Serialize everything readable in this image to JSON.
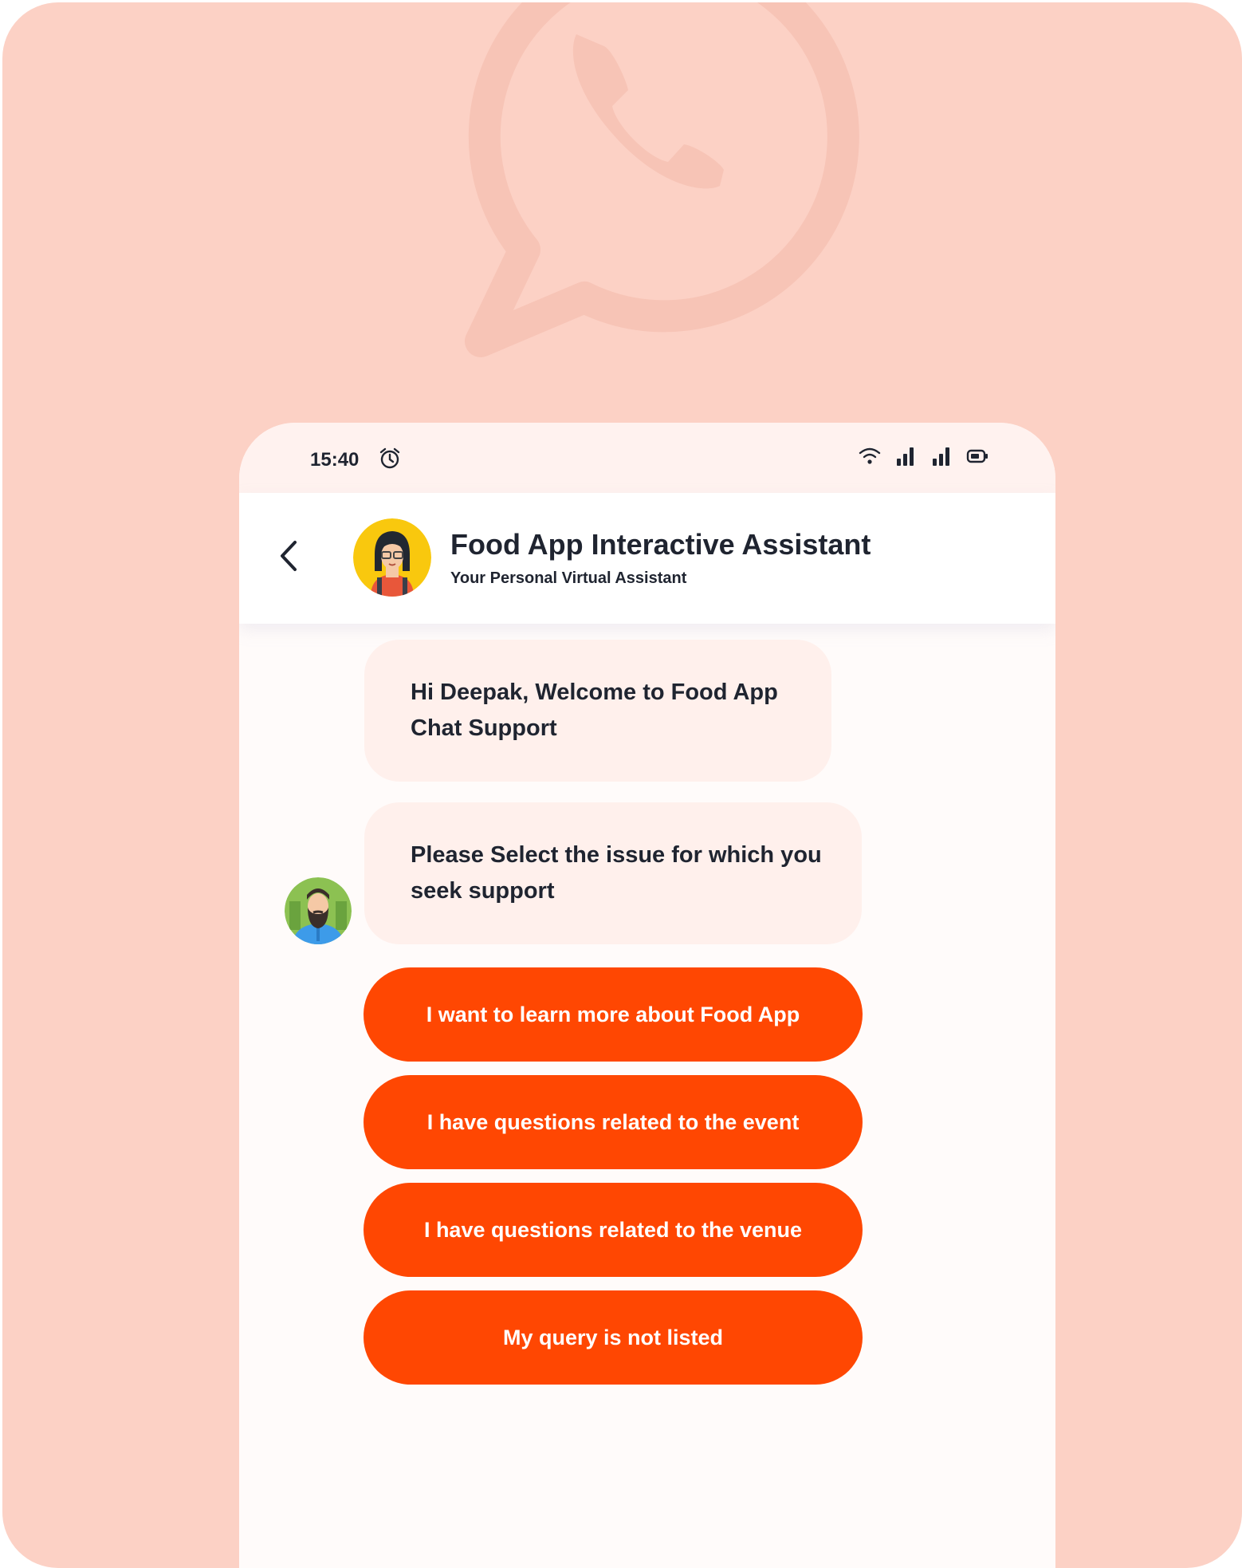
{
  "colors": {
    "background": "#fcd1c5",
    "accent": "#ff4702",
    "bubble": "#fff0ec",
    "text": "#1f2430"
  },
  "status_bar": {
    "time": "15:40",
    "icons": [
      "alarm-icon",
      "wifi-icon",
      "signal-icon",
      "signal-icon",
      "battery-icon"
    ]
  },
  "header": {
    "title": "Food App Interactive Assistant",
    "subtitle": "Your Personal Virtual Assistant",
    "back_icon": "chevron-left-icon"
  },
  "messages": [
    {
      "text": "Hi Deepak, Welcome to Food App Chat Support"
    },
    {
      "text": "Please Select the issue for which you seek support"
    }
  ],
  "options": [
    {
      "label": "I want to learn more about Food App"
    },
    {
      "label": "I have questions related to the event"
    },
    {
      "label": "I have questions related to the venue"
    },
    {
      "label": "My query is not listed"
    }
  ]
}
